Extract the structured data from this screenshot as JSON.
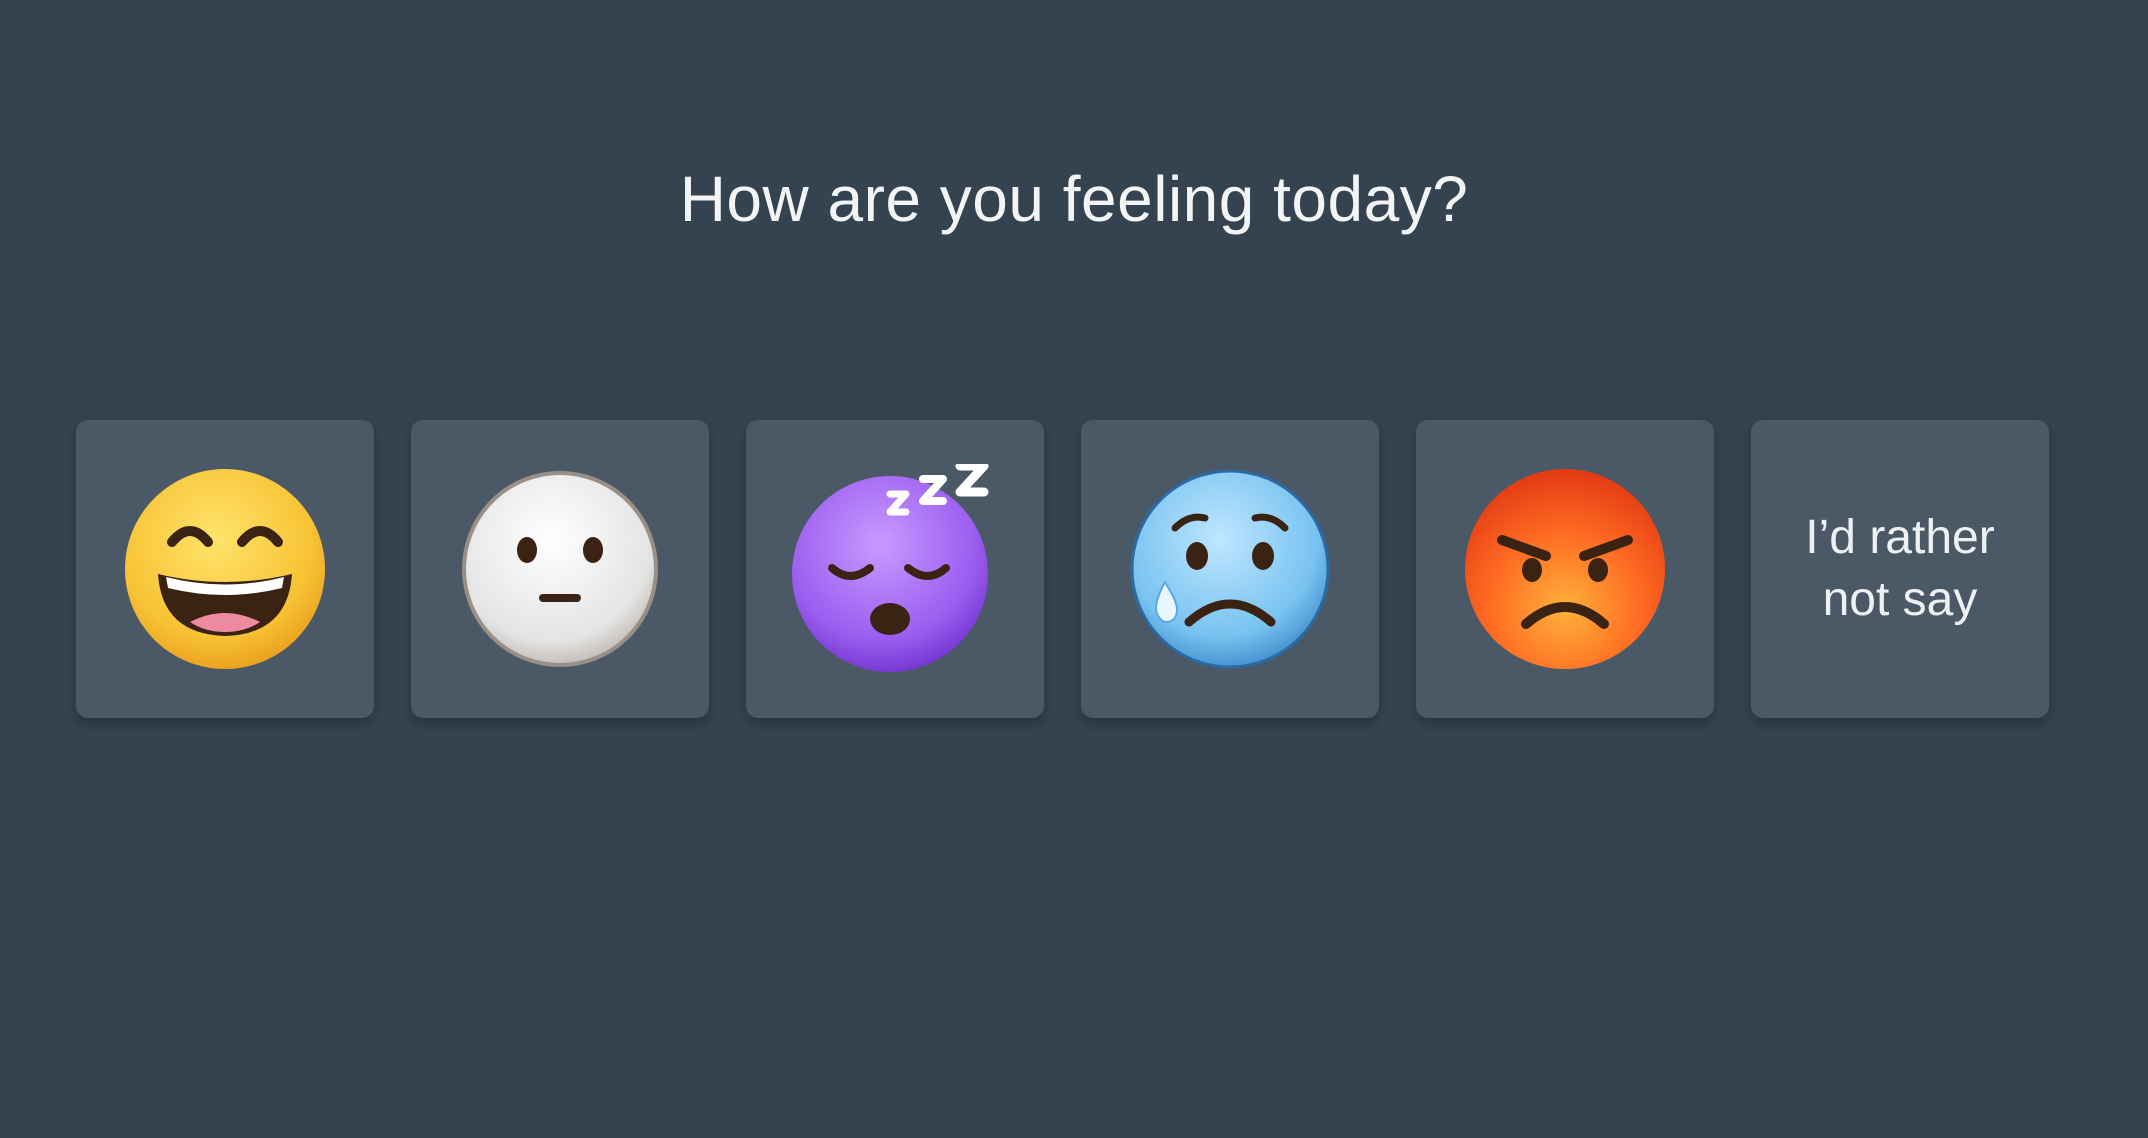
{
  "prompt": {
    "title": "How are you feeling today?"
  },
  "options": [
    {
      "icon": "grinning-face-icon"
    },
    {
      "icon": "neutral-face-icon"
    },
    {
      "icon": "sleepy-face-icon"
    },
    {
      "icon": "sad-tear-face-icon"
    },
    {
      "icon": "angry-face-icon"
    },
    {
      "label": "I’d rather not say"
    }
  ],
  "colors": {
    "background": "#35424f",
    "card": "#4b5967",
    "text": "#f2f4f6"
  }
}
